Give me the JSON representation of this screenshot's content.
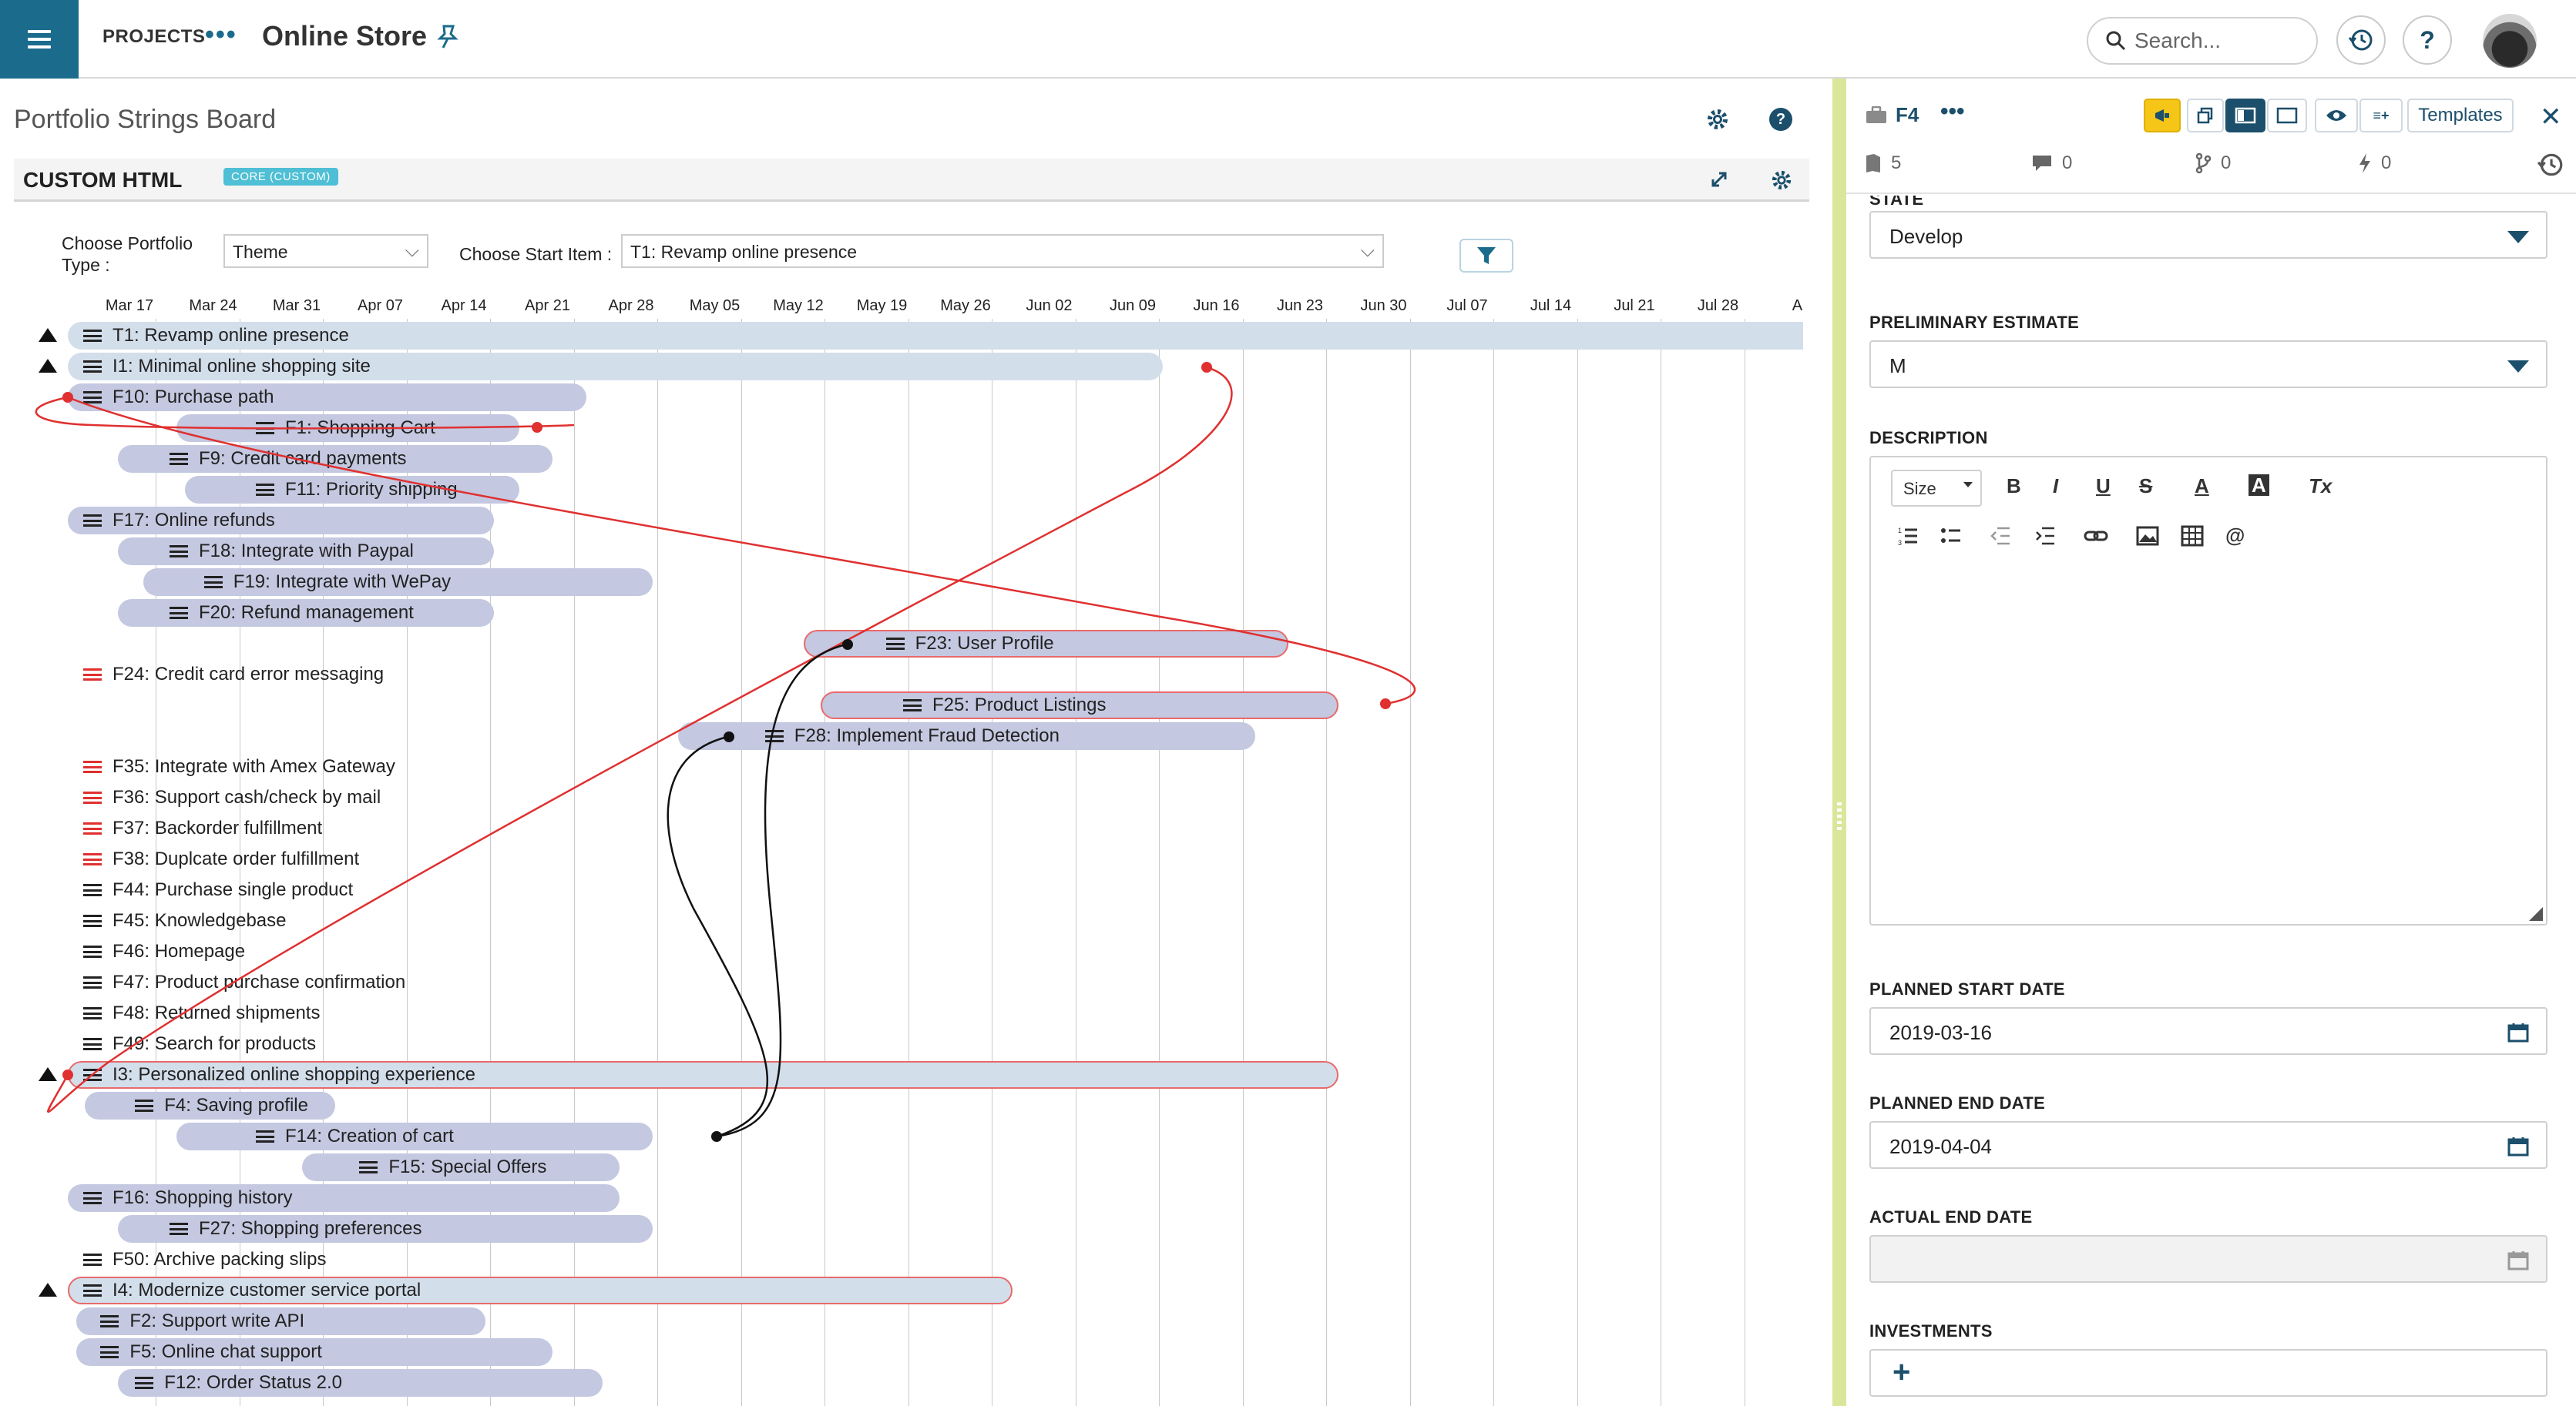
{
  "topbar": {
    "projects_label": "PROJECTS",
    "projects_more": "•••",
    "project_title": "Online Store",
    "search_placeholder": "Search...",
    "help_label": "?"
  },
  "board": {
    "title": "Portfolio Strings Board",
    "help_label": "?",
    "app_name": "CUSTOM HTML",
    "app_badge": "CORE (CUSTOM)",
    "portfolio_type_label": "Choose Portfolio Type :",
    "portfolio_type_value": "Theme",
    "start_item_label": "Choose Start Item :",
    "start_item_value": "T1: Revamp online presence",
    "chevron": "⌵"
  },
  "gantt": {
    "dates": [
      "Mar 17",
      "Mar 24",
      "Mar 31",
      "Apr 07",
      "Apr 14",
      "Apr 21",
      "Apr 28",
      "May 05",
      "May 12",
      "May 19",
      "May 26",
      "Jun 02",
      "Jun 09",
      "Jun 16",
      "Jun 23",
      "Jun 30",
      "Jul 07",
      "Jul 14",
      "Jul 21",
      "Jul 28",
      "Au"
    ],
    "rows": [
      {
        "label": "T1: Revamp online presence",
        "indent": 0,
        "bar": [
          0,
          21.4
        ],
        "tri": true,
        "style": "blue",
        "icon": "black"
      },
      {
        "label": "I1: Minimal online shopping site",
        "indent": 0,
        "bar": [
          0,
          13.1
        ],
        "tri": true,
        "style": "blue",
        "icon": "black"
      },
      {
        "label": "F10: Purchase path",
        "indent": 0,
        "bar": [
          0,
          6.2
        ],
        "tri": false,
        "style": "purple",
        "icon": "black"
      },
      {
        "label": "F1: Shopping Cart",
        "indent": 2,
        "bar": [
          1.3,
          5.4
        ],
        "tri": false,
        "style": "purple",
        "icon": "black"
      },
      {
        "label": "F9: Credit card payments",
        "indent": 1,
        "bar": [
          0.6,
          5.8
        ],
        "tri": false,
        "style": "purple",
        "icon": "black"
      },
      {
        "label": "F11: Priority shipping",
        "indent": 2,
        "bar": [
          1.4,
          5.4
        ],
        "tri": false,
        "style": "purple",
        "icon": "black"
      },
      {
        "label": "F17: Online refunds",
        "indent": 0,
        "bar": [
          0,
          5.1
        ],
        "tri": false,
        "style": "purple",
        "icon": "black"
      },
      {
        "label": "F18: Integrate with Paypal",
        "indent": 1,
        "bar": [
          0.6,
          5.1
        ],
        "tri": false,
        "style": "purple",
        "icon": "black"
      },
      {
        "label": "F19: Integrate with WePay",
        "indent": 1.4,
        "bar": [
          0.9,
          7.0
        ],
        "tri": false,
        "style": "purple",
        "icon": "black"
      },
      {
        "label": "F20: Refund management",
        "indent": 1,
        "bar": [
          0.6,
          5.1
        ],
        "tri": false,
        "style": "purple",
        "icon": "black"
      },
      {
        "label": "F23: User Profile",
        "indent": 9.3,
        "bar": [
          8.8,
          14.6
        ],
        "tri": false,
        "style": "purple-red",
        "icon": "black"
      },
      {
        "label": "F24: Credit card error messaging",
        "indent": 0,
        "bar": null,
        "tri": false,
        "style": "none",
        "icon": "red"
      },
      {
        "label": "F25: Product Listings",
        "indent": 9.5,
        "bar": [
          9.0,
          15.2
        ],
        "tri": false,
        "style": "purple-red",
        "icon": "black"
      },
      {
        "label": "F28: Implement Fraud Detection",
        "indent": 7.9,
        "bar": [
          7.3,
          14.2
        ],
        "tri": false,
        "style": "purple",
        "icon": "black"
      },
      {
        "label": "F35: Integrate with Amex Gateway",
        "indent": 0,
        "bar": null,
        "tri": false,
        "style": "none",
        "icon": "red"
      },
      {
        "label": "F36: Support cash/check by mail",
        "indent": 0,
        "bar": null,
        "tri": false,
        "style": "none",
        "icon": "red"
      },
      {
        "label": "F37: Backorder fulfillment",
        "indent": 0,
        "bar": null,
        "tri": false,
        "style": "none",
        "icon": "red"
      },
      {
        "label": "F38: Duplcate order fulfillment",
        "indent": 0,
        "bar": null,
        "tri": false,
        "style": "none",
        "icon": "red"
      },
      {
        "label": "F44: Purchase single product",
        "indent": 0,
        "bar": null,
        "tri": false,
        "style": "none",
        "icon": "black"
      },
      {
        "label": "F45: Knowledgebase",
        "indent": 0,
        "bar": null,
        "tri": false,
        "style": "none",
        "icon": "black"
      },
      {
        "label": "F46: Homepage",
        "indent": 0,
        "bar": null,
        "tri": false,
        "style": "none",
        "icon": "black"
      },
      {
        "label": "F47: Product purchase confirmation",
        "indent": 0,
        "bar": null,
        "tri": false,
        "style": "none",
        "icon": "black"
      },
      {
        "label": "F48: Returned shipments",
        "indent": 0,
        "bar": null,
        "tri": false,
        "style": "none",
        "icon": "black"
      },
      {
        "label": "F49: Search for products",
        "indent": 0,
        "bar": null,
        "tri": false,
        "style": "none",
        "icon": "black"
      },
      {
        "label": "I3: Personalized online shopping experience",
        "indent": 0,
        "bar": [
          0,
          15.2
        ],
        "tri": true,
        "style": "blue-red",
        "icon": "black"
      },
      {
        "label": "F4: Saving profile",
        "indent": 0.6,
        "bar": [
          0.2,
          3.2
        ],
        "tri": false,
        "style": "purple",
        "icon": "black"
      },
      {
        "label": "F14: Creation of cart",
        "indent": 2,
        "bar": [
          1.3,
          7.0
        ],
        "tri": false,
        "style": "purple",
        "icon": "black"
      },
      {
        "label": "F15: Special Offers",
        "indent": 3.2,
        "bar": [
          2.8,
          6.6
        ],
        "tri": false,
        "style": "purple",
        "icon": "black"
      },
      {
        "label": "F16: Shopping history",
        "indent": 0,
        "bar": [
          0,
          6.6
        ],
        "tri": false,
        "style": "purple",
        "icon": "black"
      },
      {
        "label": "F27: Shopping preferences",
        "indent": 1,
        "bar": [
          0.6,
          7.0
        ],
        "tri": false,
        "style": "purple",
        "icon": "black"
      },
      {
        "label": "F50: Archive packing slips",
        "indent": 0,
        "bar": null,
        "tri": false,
        "style": "none",
        "icon": "black"
      },
      {
        "label": "I4: Modernize customer service portal",
        "indent": 0,
        "bar": [
          0,
          11.3
        ],
        "tri": true,
        "style": "blue-red",
        "icon": "black"
      },
      {
        "label": "F2: Support write API",
        "indent": 0.2,
        "bar": [
          0.1,
          5.0
        ],
        "tri": false,
        "style": "purple",
        "icon": "black"
      },
      {
        "label": "F5: Online chat support",
        "indent": 0.2,
        "bar": [
          0.1,
          5.8
        ],
        "tri": false,
        "style": "purple",
        "icon": "black"
      },
      {
        "label": "F12: Order Status 2.0",
        "indent": 0.6,
        "bar": [
          0.6,
          6.4
        ],
        "tri": false,
        "style": "purple",
        "icon": "black"
      }
    ]
  },
  "detail": {
    "id": "F4",
    "more": "•••",
    "templates_label": "Templates",
    "close_label": "✕",
    "stats": {
      "attachments": "5",
      "comments": "0",
      "branches": "0",
      "bolts": "0"
    },
    "state_label": "STATE",
    "state_value": "Develop",
    "estimate_label": "PRELIMINARY ESTIMATE",
    "estimate_value": "M",
    "description_label": "DESCRIPTION",
    "rte": {
      "size_label": "Size",
      "bold": "B",
      "italic": "I",
      "underline": "U",
      "strike": "S",
      "text_color": "A",
      "bg_color": "A",
      "clear": "Tx",
      "mention": "@"
    },
    "planned_start_label": "PLANNED START DATE",
    "planned_start_value": "2019-03-16",
    "planned_end_label": "PLANNED END DATE",
    "planned_end_value": "2019-04-04",
    "actual_end_label": "ACTUAL END DATE",
    "actual_end_value": "",
    "investments_label": "INVESTMENTS",
    "add_label": "+"
  },
  "colors": {
    "brand": "#1b6b8c",
    "bar_blue": "#d3deeb",
    "bar_purple": "#c4c8e0",
    "alert_red": "#e03030",
    "splitter": "#dbe69a",
    "pin_yellow": "#f5c518"
  }
}
